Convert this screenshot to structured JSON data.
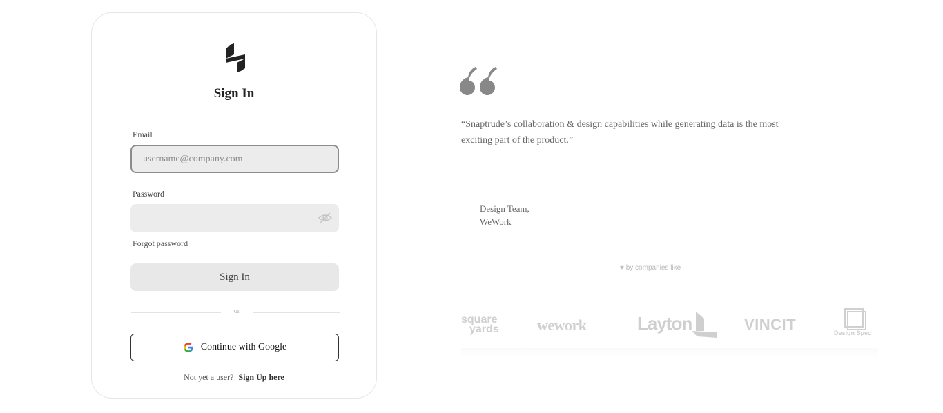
{
  "signin": {
    "title": "Sign In",
    "email_label": "Email",
    "email_placeholder": "username@company.com",
    "email_value": "",
    "password_label": "Password",
    "password_value": "",
    "forgot_label": "Forgot password",
    "submit_label": "Sign In",
    "divider_text": "or",
    "google_label": "Continue with Google",
    "signup_prompt": "Not yet a user?",
    "signup_link": "Sign Up here"
  },
  "testimonial": {
    "quote": "“Snaptrude’s collaboration & design capabilities while generating data is the most exciting part of the product.”",
    "author_line1": "Design Team,",
    "author_line2": "WeWork"
  },
  "companies": {
    "label": "by companies like",
    "logos": [
      {
        "name": "square yards",
        "line1": "square",
        "line2": "yards"
      },
      {
        "name": "wework",
        "text": "wework"
      },
      {
        "name": "Layton",
        "text": "Layton"
      },
      {
        "name": "VINCIT",
        "text": "VINCIT"
      },
      {
        "name": "Design Spec",
        "text": "Design Spec"
      }
    ]
  },
  "icons": {
    "logo": "snaptrude-logo-icon",
    "eye": "eye-off-icon",
    "google": "google-icon",
    "quote": "quote-icon",
    "heart": "heart-icon"
  },
  "colors": {
    "brand_dark": "#222222",
    "field_bg": "#ececec",
    "muted_text": "#666666"
  }
}
